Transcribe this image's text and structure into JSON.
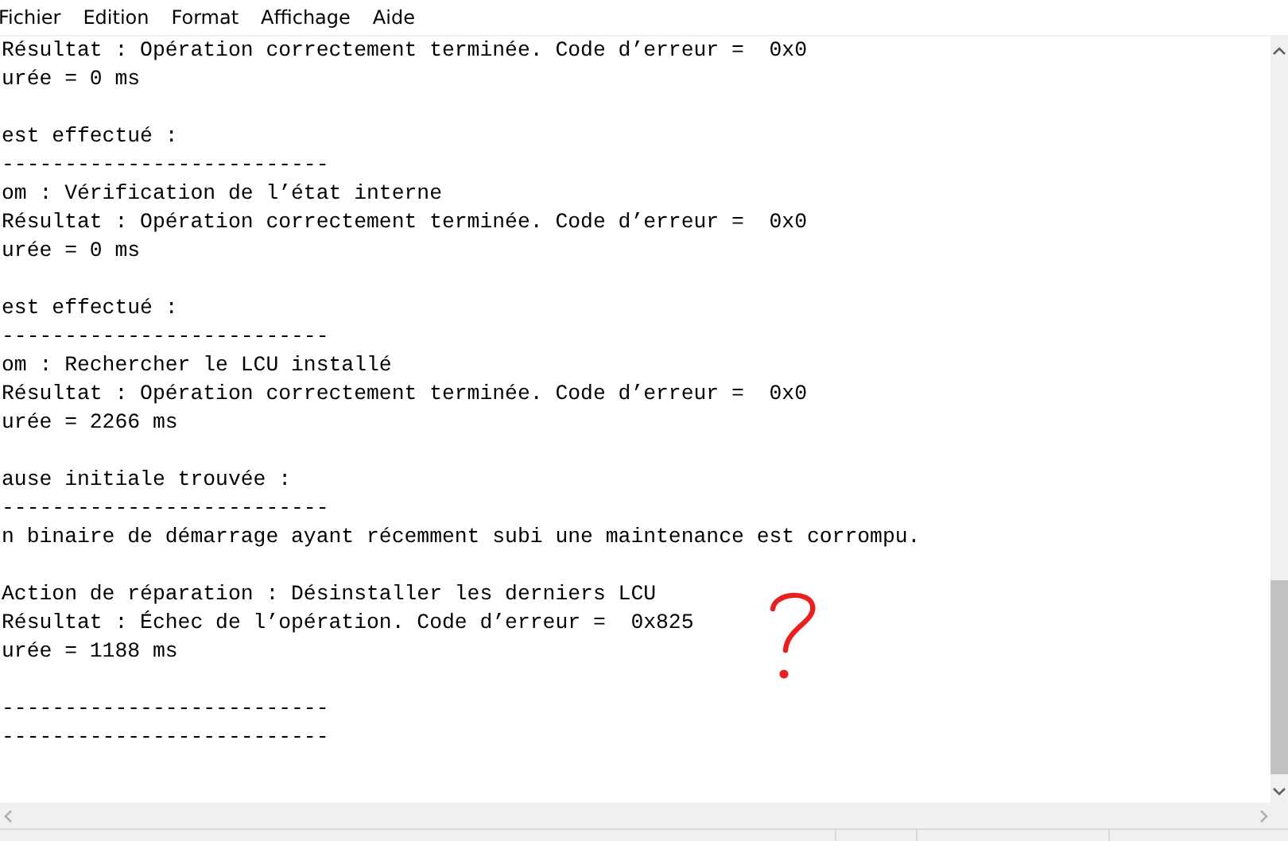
{
  "menu": [
    "Fichier",
    "Edition",
    "Format",
    "Affichage",
    "Aide"
  ],
  "paragraphs": [
    [
      "Résultat : Opération correctement terminée. Code d’erreur =  0x0",
      "urée = 0 ms"
    ],
    [
      "est effectué :",
      "--------------------------",
      "om : Vérification de l’état interne",
      "Résultat : Opération correctement terminée. Code d’erreur =  0x0",
      "urée = 0 ms"
    ],
    [
      "est effectué :",
      "--------------------------",
      "om : Rechercher le LCU installé",
      "Résultat : Opération correctement terminée. Code d’erreur =  0x0",
      "urée = 2266 ms"
    ],
    [
      "ause initiale trouvée :",
      "--------------------------",
      "n binaire de démarrage ayant récemment subi une maintenance est corrompu."
    ],
    [
      "Action de réparation : Désinstaller les derniers LCU",
      "Résultat : Échec de l’opération. Code d’erreur =  0x825",
      "urée = 1188 ms"
    ],
    [
      "--------------------------",
      "--------------------------"
    ]
  ]
}
